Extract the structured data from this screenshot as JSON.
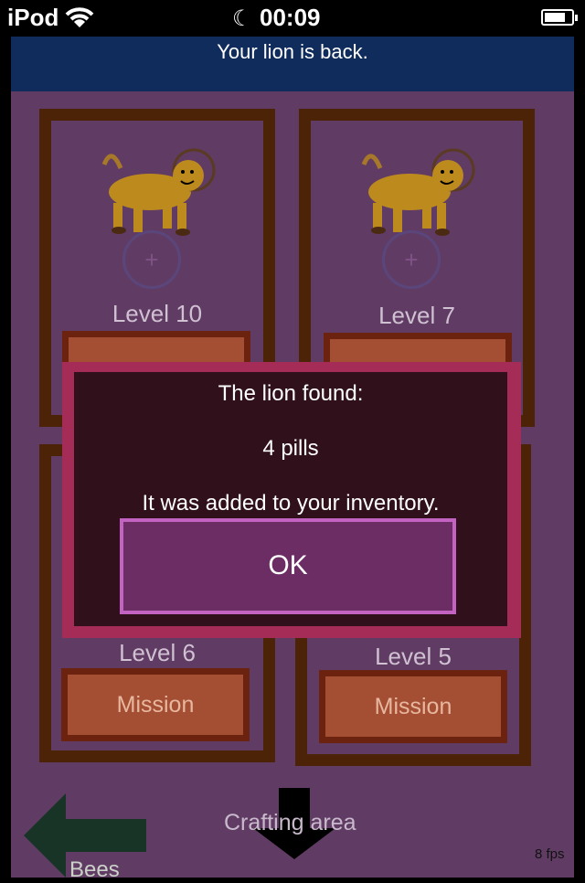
{
  "status_bar": {
    "carrier": "iPod",
    "wifi_icon": "wifi-icon",
    "moon_icon": "moon-icon",
    "time": "00:09",
    "battery_icon": "battery-icon"
  },
  "banner": {
    "text": "Your lion is back."
  },
  "cards": [
    {
      "level": "Level 10",
      "mission_label": "",
      "lion_icon": "lion-icon",
      "slot_icon": "plus-slot-icon"
    },
    {
      "level": "Level 7",
      "mission_label": "",
      "lion_icon": "lion-icon",
      "slot_icon": "plus-slot-icon"
    },
    {
      "level": "Level 6",
      "mission_label": "Mission"
    },
    {
      "level": "Level 5",
      "mission_label": "Mission"
    }
  ],
  "nav": {
    "bees_label": "Bees",
    "crafting_label": "Crafting area"
  },
  "fps": "8 fps",
  "dialog": {
    "title": "The lion found:",
    "item": "4 pills",
    "message": "It was added to your inventory.",
    "ok_label": "OK"
  },
  "colors": {
    "background": "#603c64",
    "banner": "#0f2c5c",
    "card_border": "#4d2307",
    "mission_button": "#a44f34",
    "dialog_border": "#a42c56",
    "dialog_bg": "#30101b",
    "ok_button": "#6b2d63",
    "bees_arrow": "#173427"
  }
}
